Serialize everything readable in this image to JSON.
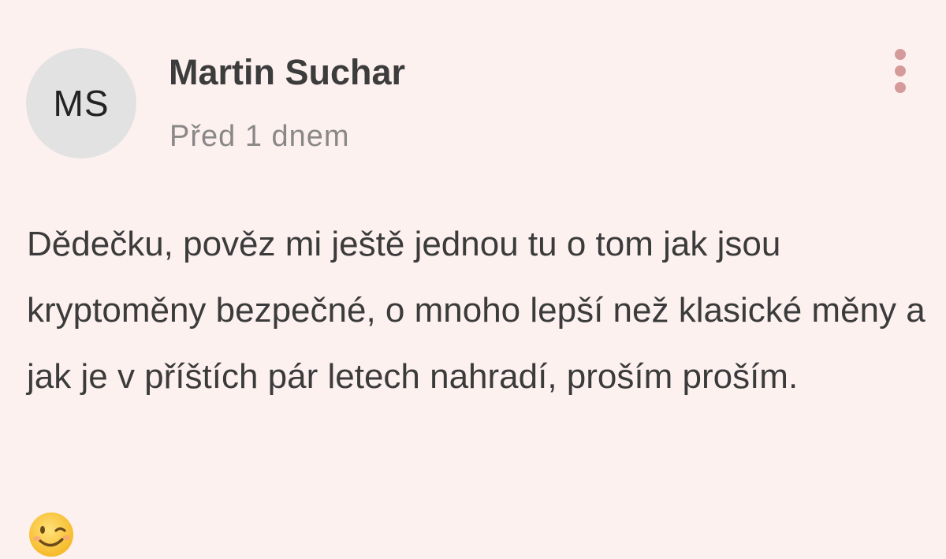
{
  "comment": {
    "avatar_initials": "MS",
    "author": "Martin Suchar",
    "timestamp": "Před 1 dnem",
    "text": "Dědečku, pověz mi ještě jednou tu o tom jak jsou kryptoměny bezpečné, o mnoho lepší než klasické měny a jak je v příštích pár letech nahradí, proším proším.",
    "emoji": "winking-face-emoji",
    "more_icon": "more-vertical-icon"
  },
  "colors": {
    "background": "#fdf1f0",
    "avatar_bg": "#e2e2e2",
    "author_text": "#3c3c3c",
    "timestamp_text": "#8a8787",
    "body_text": "#3b3b3b",
    "menu_dots": "#d59a9a"
  }
}
